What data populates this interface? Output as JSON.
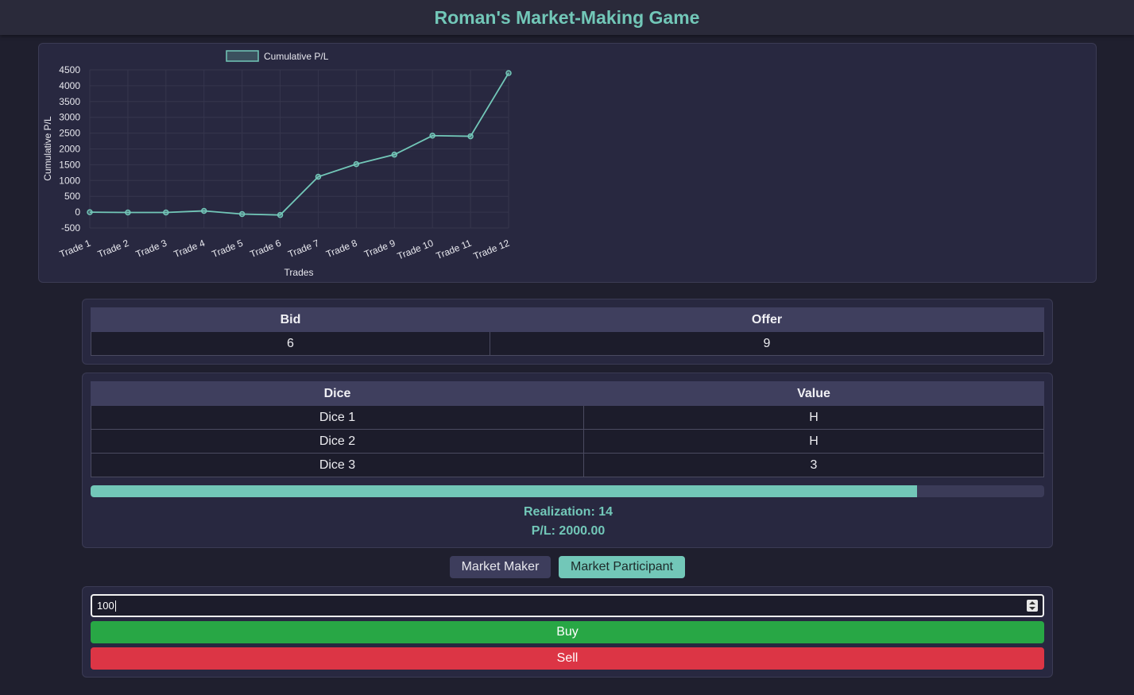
{
  "header": {
    "title": "Roman's Market-Making Game"
  },
  "chart_data": {
    "type": "line",
    "legend_label": "Cumulative P/L",
    "legend_position": "top",
    "xlabel": "Trades",
    "ylabel": "Cumulative P/L",
    "categories": [
      "Trade 1",
      "Trade 2",
      "Trade 3",
      "Trade 4",
      "Trade 5",
      "Trade 6",
      "Trade 7",
      "Trade 8",
      "Trade 9",
      "Trade 10",
      "Trade 11",
      "Trade 12"
    ],
    "series": [
      {
        "name": "Cumulative P/L",
        "values": [
          0,
          -10,
          -10,
          40,
          -60,
          -90,
          1120,
          1520,
          1820,
          2420,
          2400,
          4400
        ]
      }
    ],
    "ylim": [
      -500,
      4500
    ],
    "yticks": [
      "4500",
      "4000",
      "3500",
      "3000",
      "2500",
      "2000",
      "1500",
      "1000",
      "500",
      "0",
      "-500"
    ],
    "grid": true,
    "color": "#72c7b8"
  },
  "quote": {
    "headers": {
      "bid": "Bid",
      "offer": "Offer"
    },
    "bid": "6",
    "offer": "9"
  },
  "dice": {
    "headers": {
      "dice": "Dice",
      "value": "Value"
    },
    "rows": [
      {
        "name": "Dice 1",
        "value": "H"
      },
      {
        "name": "Dice 2",
        "value": "H"
      },
      {
        "name": "Dice 3",
        "value": "3"
      }
    ]
  },
  "progress": 0.867,
  "realization": "Realization: 14",
  "pl": "P/L: 2000.00",
  "modes": {
    "maker": "Market Maker",
    "participant": "Market Participant"
  },
  "trade": {
    "quantity": "100",
    "buy_label": "Buy",
    "sell_label": "Sell"
  }
}
